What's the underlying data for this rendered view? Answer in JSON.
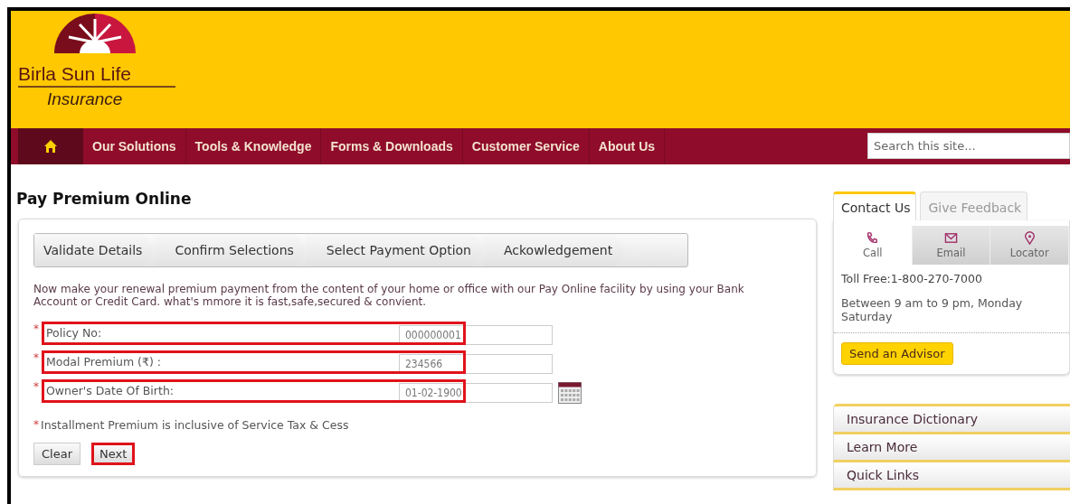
{
  "header": {
    "logo_line1": "Birla Sun Life",
    "logo_line2": "Insurance"
  },
  "nav": {
    "items": [
      {
        "label": "Our Solutions",
        "selected": false
      },
      {
        "label": "Tools & Knowledge",
        "selected": false
      },
      {
        "label": "Forms & Downloads",
        "selected": false
      },
      {
        "label": "Customer Service",
        "selected": false
      },
      {
        "label": "About Us",
        "selected": false
      }
    ],
    "home_selected": true,
    "search": {
      "placeholder": "Search this site..."
    }
  },
  "page_title": "Pay Premium Online",
  "steps": [
    {
      "label": "Validate Details"
    },
    {
      "label": "Confirm Selections"
    },
    {
      "label": "Select Payment Option"
    },
    {
      "label": "Ackowledgement"
    }
  ],
  "intro": "Now make your renewal premium payment from the content of your home or office with our Pay Online facility by using your Bank Account or Credit Card. what's mmore it is fast,safe,secured & convient.",
  "fields": [
    {
      "kind": "text",
      "marker": "*",
      "label": "Policy No:",
      "value": "000000001",
      "highlighted": true
    },
    {
      "kind": "text",
      "marker": "*",
      "label": "Modal Premium (₹) :",
      "value": "234566",
      "highlighted": true
    },
    {
      "kind": "date",
      "marker": "*",
      "label": "Owner's Date Of Birth:",
      "value": "01-02-1900",
      "highlighted": true
    }
  ],
  "note": {
    "marker": "*",
    "text": "Installment Premium is inclusive of Service Tax & Cess"
  },
  "buttons": [
    {
      "label": "Clear",
      "highlighted": false
    },
    {
      "label": "Next",
      "highlighted": true
    }
  ],
  "contact": {
    "tabs": [
      {
        "label": "Contact Us",
        "selected": true
      },
      {
        "label": "Give Feedback",
        "selected": false
      }
    ],
    "modes": [
      {
        "kind": "call",
        "label": "Call",
        "selected": true
      },
      {
        "kind": "email",
        "label": "Email",
        "selected": false
      },
      {
        "kind": "locator",
        "label": "Locator",
        "selected": false
      }
    ],
    "toll_free": "Toll Free:1-800-270-7000",
    "hours": "Between 9 am to 9 pm, Monday Saturday",
    "advisor_button": "Send an Advisor"
  },
  "accordion": [
    {
      "label": "Insurance Dictionary"
    },
    {
      "label": "Learn More"
    },
    {
      "label": "Quick Links"
    }
  ]
}
